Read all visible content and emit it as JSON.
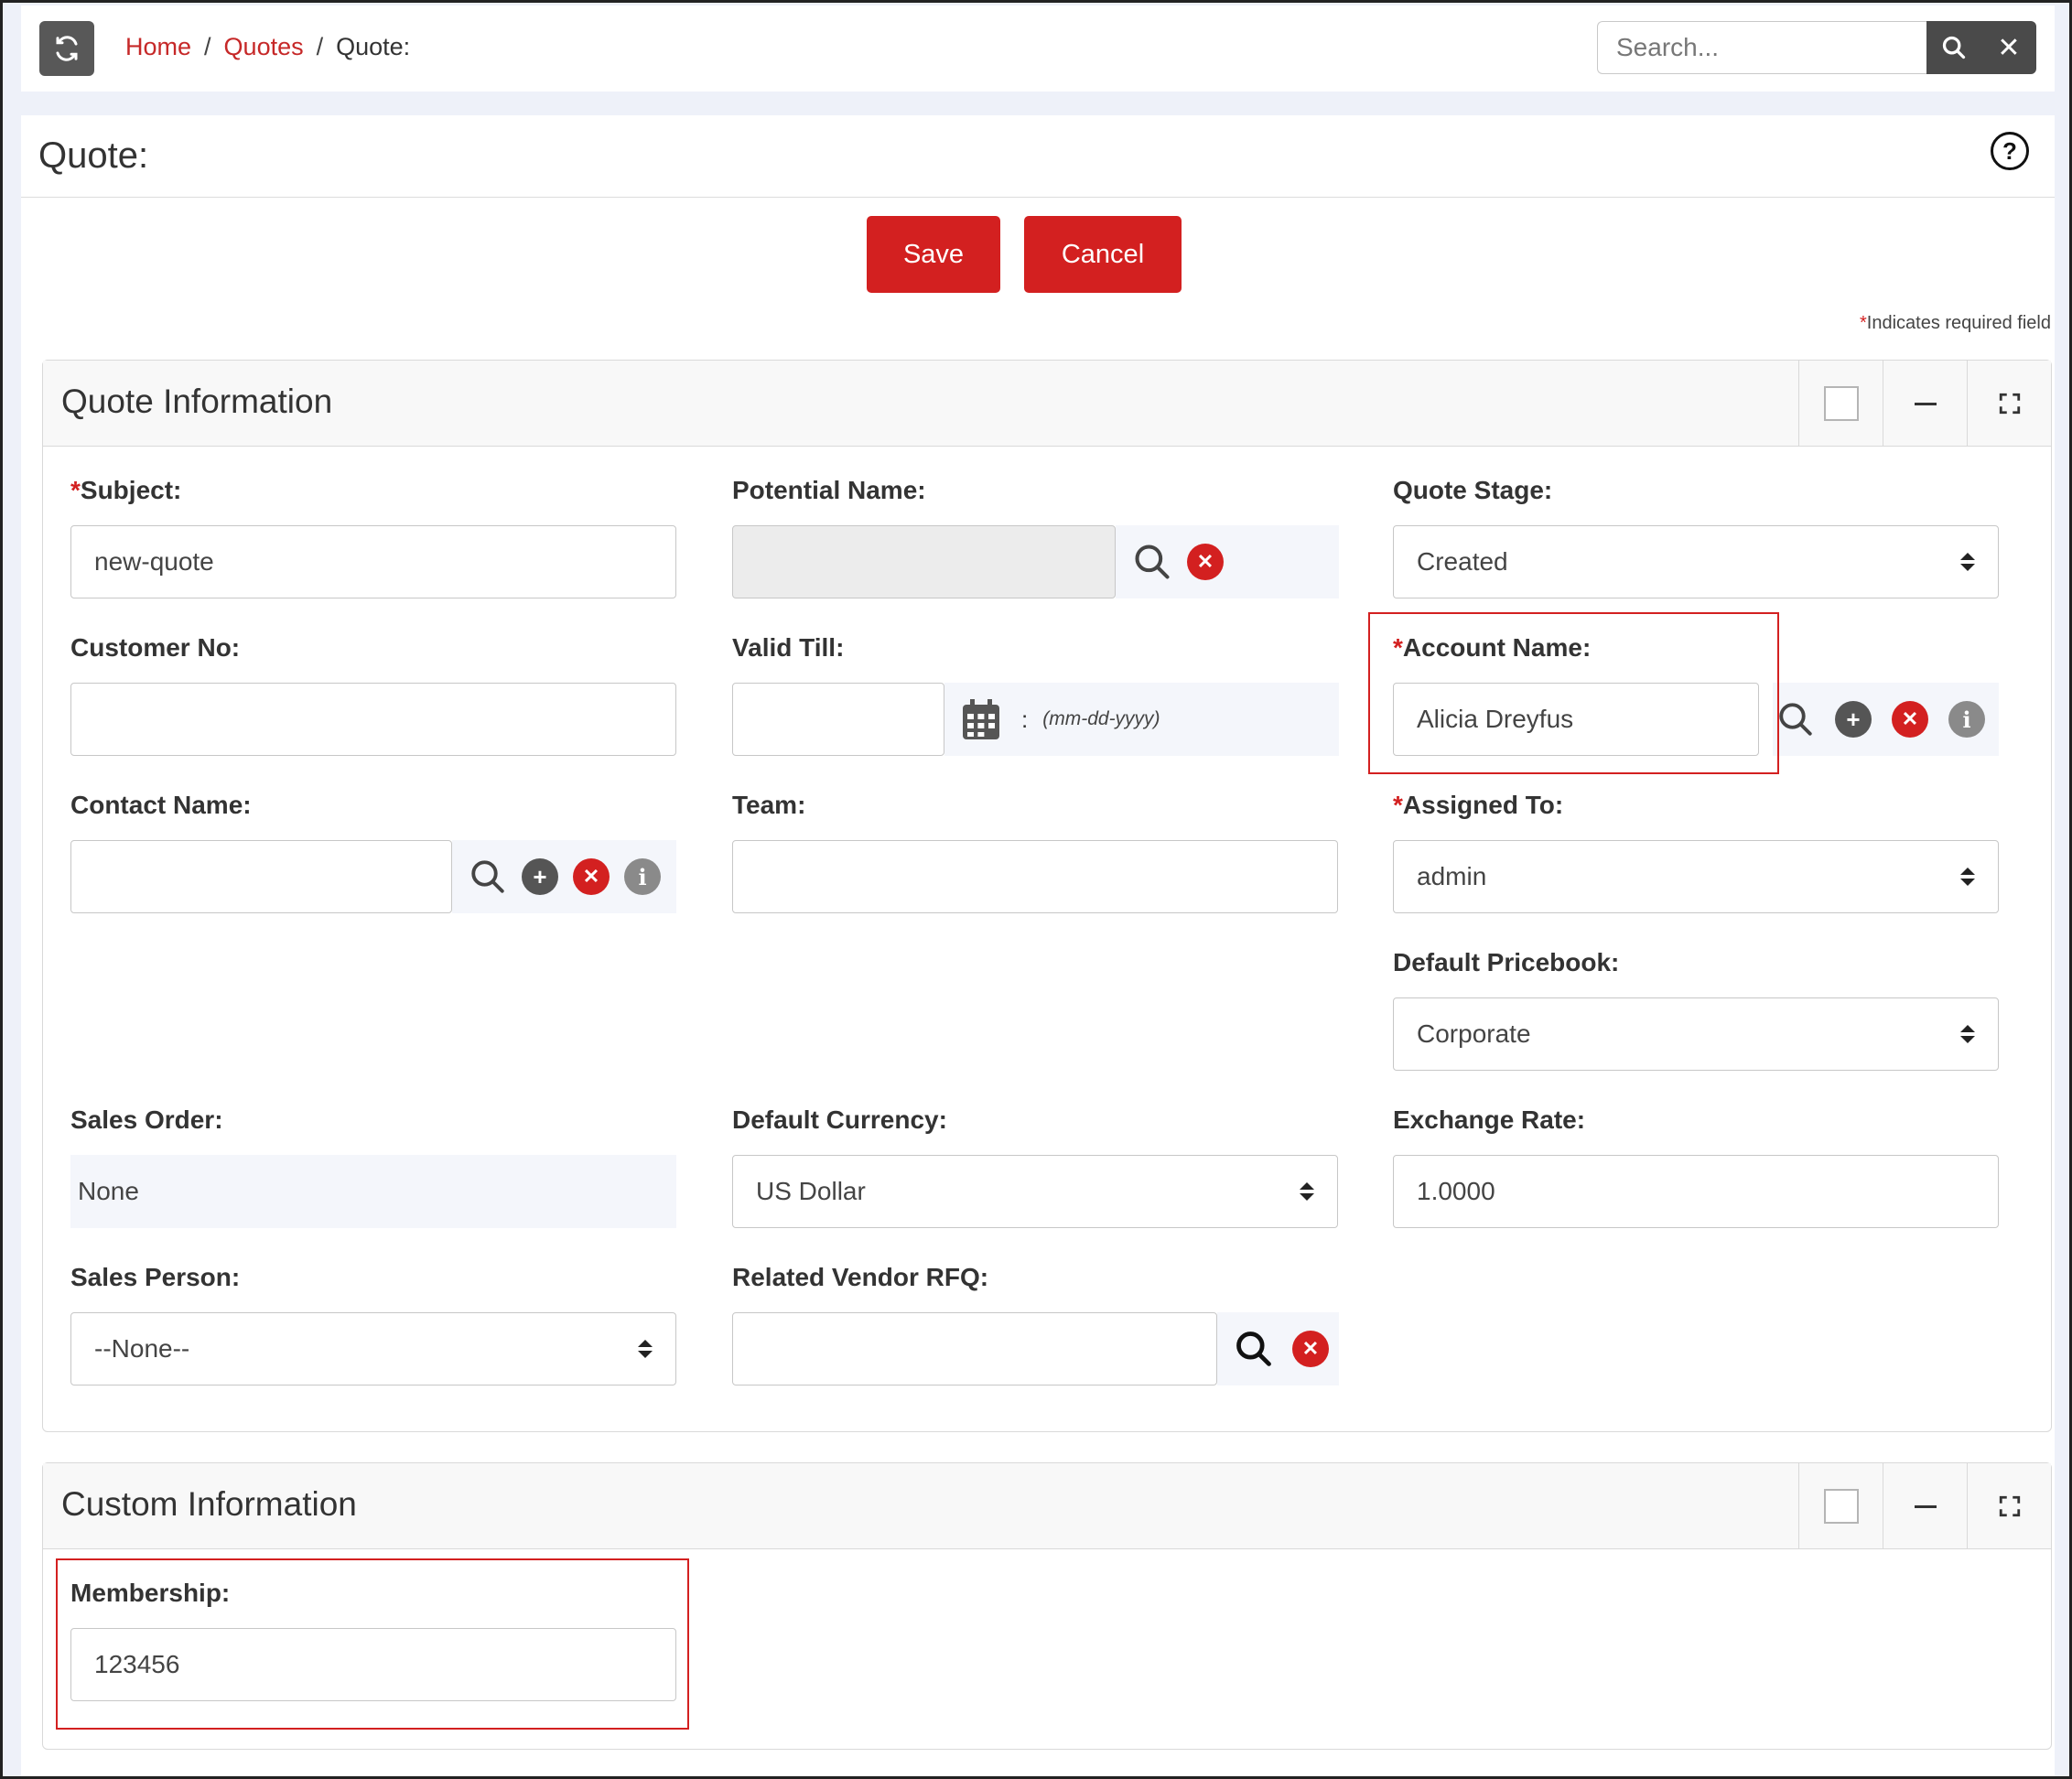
{
  "breadcrumb": {
    "home": "Home",
    "quotes": "Quotes",
    "current": "Quote:"
  },
  "search": {
    "placeholder": "Search..."
  },
  "page": {
    "title": "Quote:"
  },
  "actions": {
    "save": "Save",
    "cancel": "Cancel"
  },
  "required_note": {
    "star": "*",
    "text": "Indicates required field"
  },
  "quote_info": {
    "title": "Quote Information",
    "subject": {
      "label": "Subject:",
      "value": "new-quote",
      "required": true
    },
    "potential_name": {
      "label": "Potential Name:",
      "value": ""
    },
    "quote_stage": {
      "label": "Quote Stage:",
      "value": "Created"
    },
    "customer_no": {
      "label": "Customer No:",
      "value": ""
    },
    "valid_till": {
      "label": "Valid Till:",
      "value": "",
      "colon": ":",
      "format_hint": "(mm-dd-yyyy)"
    },
    "account_name": {
      "label": "Account Name:",
      "value": "Alicia Dreyfus",
      "required": true
    },
    "contact_name": {
      "label": "Contact Name:",
      "value": ""
    },
    "team": {
      "label": "Team:",
      "value": ""
    },
    "assigned_to": {
      "label": "Assigned To:",
      "value": "admin",
      "required": true
    },
    "default_pricebook": {
      "label": "Default Pricebook:",
      "value": "Corporate"
    },
    "sales_order": {
      "label": "Sales Order:",
      "value": "None"
    },
    "default_currency": {
      "label": "Default Currency:",
      "value": "US Dollar"
    },
    "exchange_rate": {
      "label": "Exchange Rate:",
      "value": "1.0000"
    },
    "sales_person": {
      "label": "Sales Person:",
      "value": "--None--"
    },
    "related_vendor_rfq": {
      "label": "Related Vendor RFQ:",
      "value": ""
    }
  },
  "custom_info": {
    "title": "Custom Information",
    "membership": {
      "label": "Membership:",
      "value": "123456"
    }
  },
  "icons": {
    "refresh": "refresh-icon",
    "search": "search-icon",
    "close": "close-icon",
    "help": "help-icon",
    "lookup": "magnifier-icon",
    "add": "plus-circle-icon",
    "clear": "x-circle-icon",
    "info": "info-circle-icon",
    "calendar": "calendar-icon",
    "select": "updown-arrows-icon",
    "minimize": "minus-icon",
    "expand": "expand-icon"
  },
  "colors": {
    "accent": "#d32020",
    "link": "#c62828",
    "dark_button": "#4a4a4a"
  }
}
